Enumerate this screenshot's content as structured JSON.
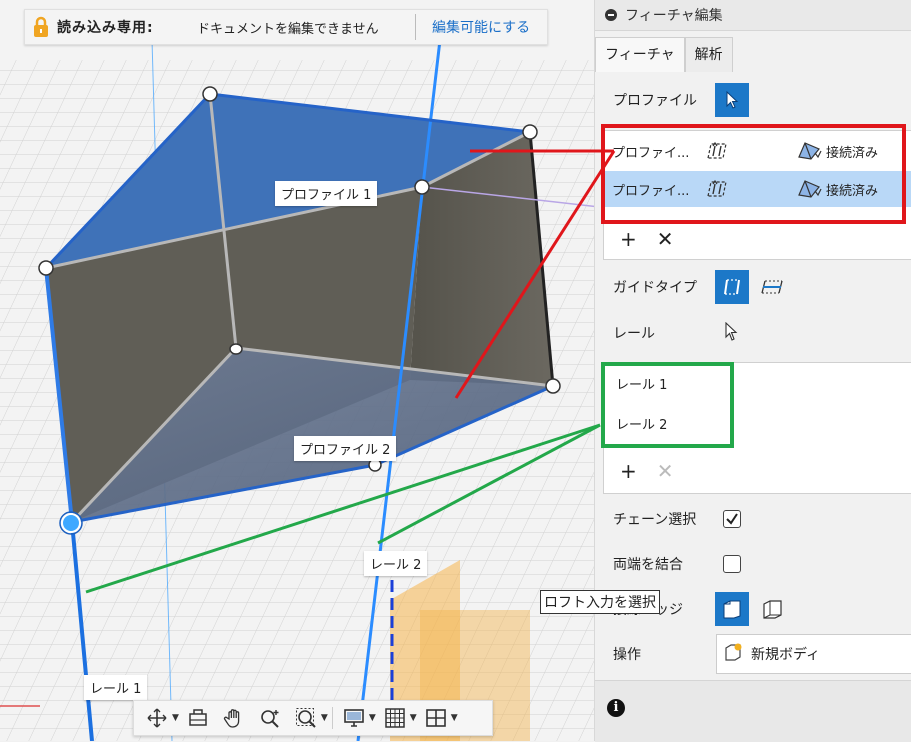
{
  "readonly_bar": {
    "label": "読み込み専用:",
    "message": "ドキュメントを編集できません",
    "make_editable": "編集可能にする"
  },
  "viewport": {
    "labels": {
      "profile1": "プロファイル 1",
      "profile2": "プロファイル 2",
      "rail1": "レール 1",
      "rail2": "レール 2"
    },
    "tooltip": "ロフト入力を選択"
  },
  "nav_toolbar": {
    "icons": [
      "orbit-icon",
      "look-at-icon",
      "pan-icon",
      "zoom-icon",
      "fit-icon",
      "display-settings-icon",
      "grid-settings-icon",
      "viewports-icon"
    ]
  },
  "panel": {
    "title": "フィーチャ編集",
    "tabs": [
      "フィーチャ",
      "解析"
    ],
    "profile_label": "プロファイル",
    "profiles": [
      {
        "name": "プロファイ...",
        "condition": "接続済み"
      },
      {
        "name": "プロファイ...",
        "condition": "接続済み"
      }
    ],
    "guide_type_label": "ガイドタイプ",
    "rail_label": "レール",
    "rails": [
      "レール 1",
      "レール 2"
    ],
    "chain_label": "チェーン選択",
    "chain_checked": true,
    "merge_ends_label": "両端を結合",
    "merge_ends_checked": false,
    "tangent_edges_label": "接線エッジ",
    "operation_label": "操作",
    "operation_value": "新規ボディ"
  },
  "colors": {
    "accent": "#1c78c8",
    "selected_row": "#b9d8f7",
    "red_annotation": "#e0161b",
    "green_annotation": "#23a84a"
  }
}
